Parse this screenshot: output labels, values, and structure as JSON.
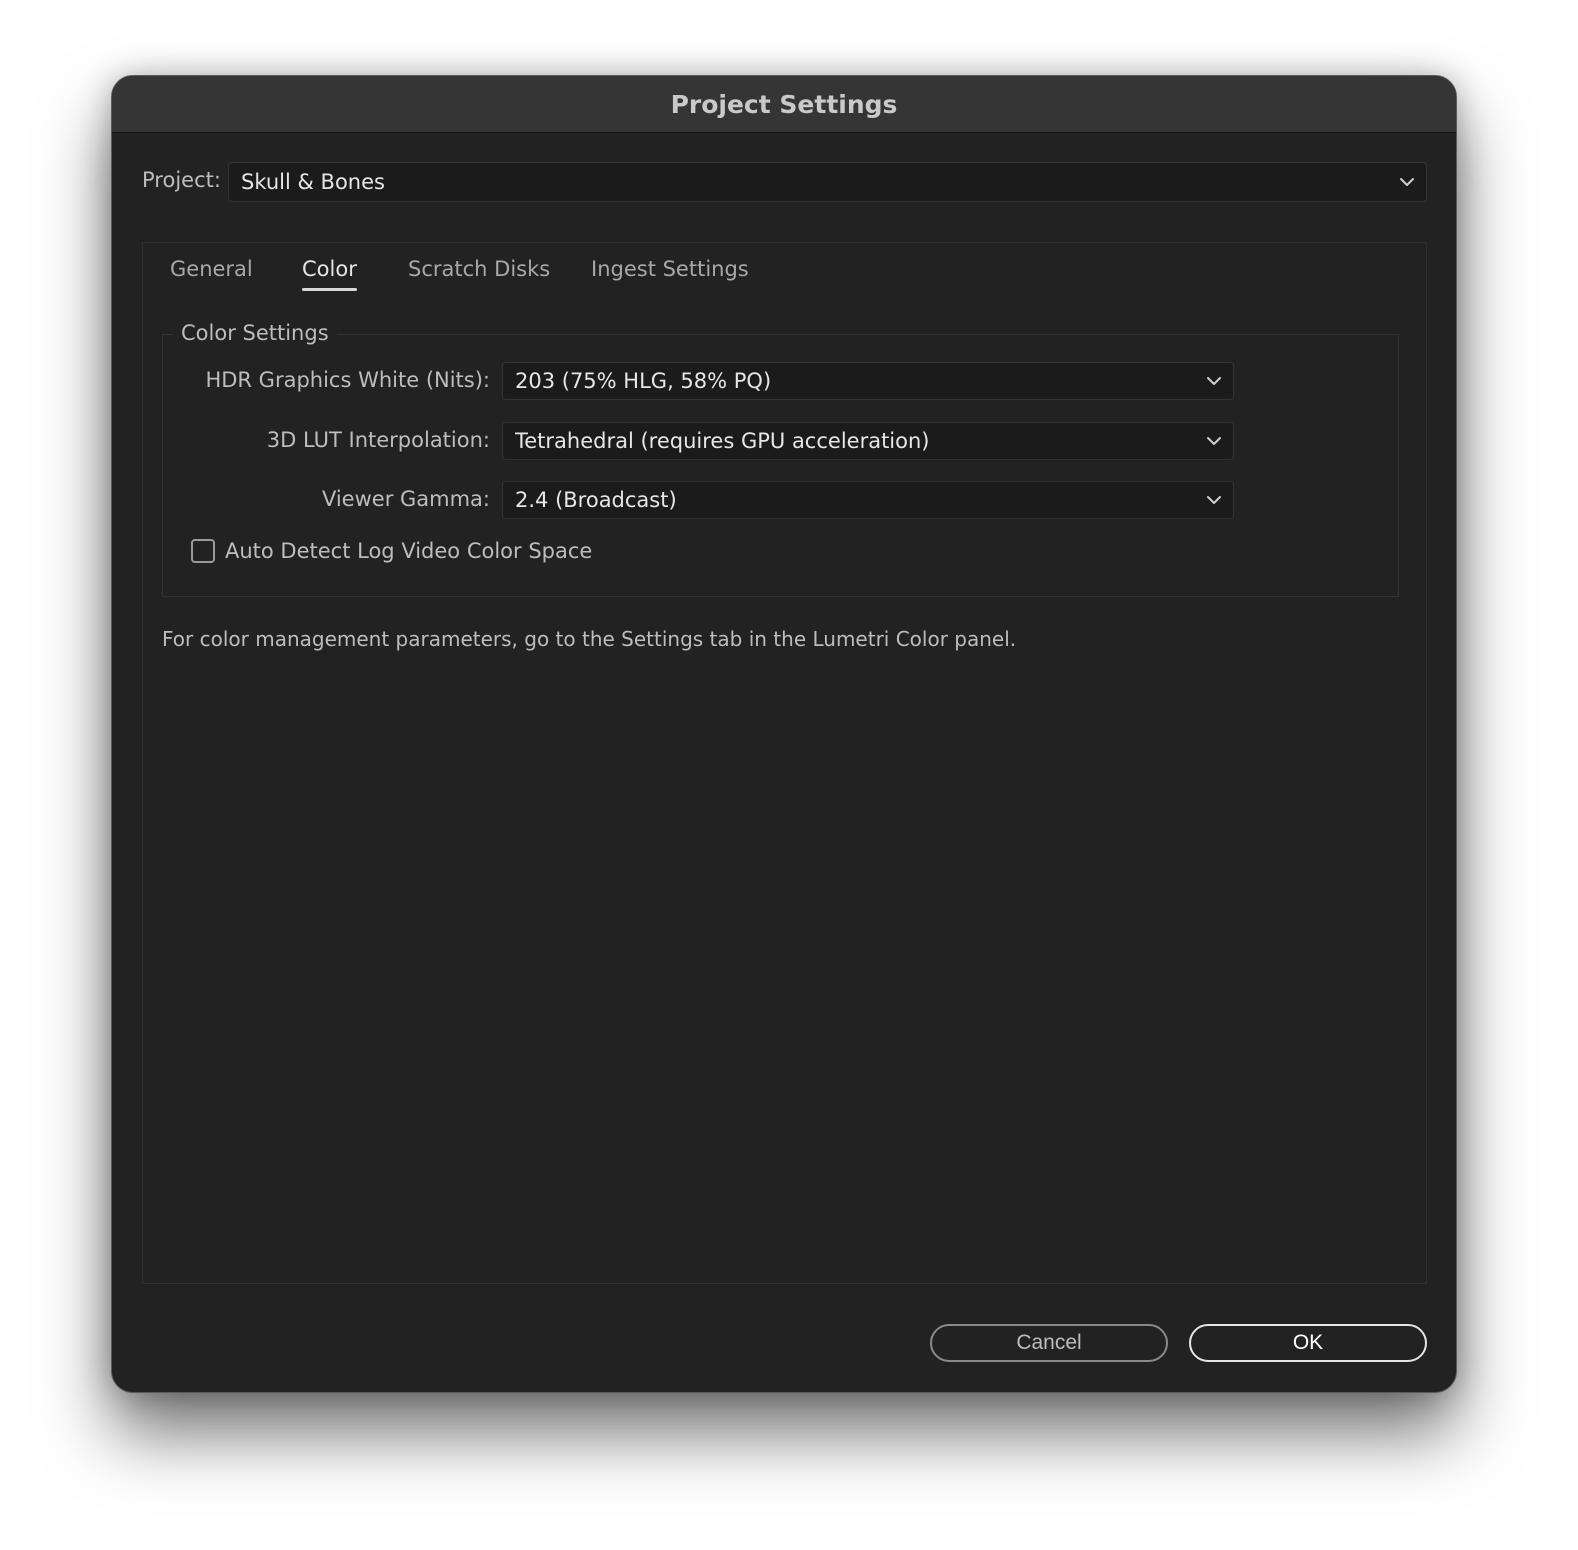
{
  "window": {
    "title": "Project Settings"
  },
  "project": {
    "label": "Project:",
    "value": "Skull & Bones"
  },
  "tabs": [
    {
      "label": "General",
      "active": false
    },
    {
      "label": "Color",
      "active": true
    },
    {
      "label": "Scratch Disks",
      "active": false
    },
    {
      "label": "Ingest Settings",
      "active": false
    }
  ],
  "color_settings": {
    "title": "Color Settings",
    "hdr_white": {
      "label": "HDR Graphics White (Nits):",
      "value": "203 (75% HLG, 58% PQ)"
    },
    "lut_interpolation": {
      "label": "3D LUT Interpolation:",
      "value": "Tetrahedral (requires GPU acceleration)"
    },
    "viewer_gamma": {
      "label": "Viewer Gamma:",
      "value": "2.4 (Broadcast)"
    },
    "auto_detect": {
      "label": "Auto Detect Log Video Color Space",
      "checked": false
    }
  },
  "note": "For color management parameters, go to the Settings tab in the Lumetri Color panel.",
  "buttons": {
    "cancel": "Cancel",
    "ok": "OK"
  },
  "icons": {
    "dropdown": "chevron-down-icon"
  },
  "colors": {
    "window_bg": "#222222",
    "titlebar_bg": "#353535",
    "field_bg": "#1b1b1b",
    "text": "#bdbdbd",
    "text_bright": "#e6e6e6"
  }
}
